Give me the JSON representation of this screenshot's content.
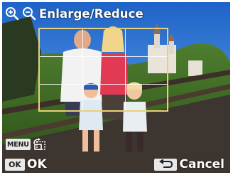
{
  "header": {
    "title": "Enlarge/Reduce",
    "zoom_in_icon": "zoom-in-icon",
    "zoom_out_icon": "zoom-out-icon"
  },
  "image": {
    "description_icon": "family-photo"
  },
  "menu": {
    "menu_label": "MENU",
    "rotate_icon": "rotate-frame-icon"
  },
  "footer": {
    "ok_chip": "OK",
    "ok_label": "OK",
    "back_icon": "back-arrow-icon",
    "cancel_label": "Cancel"
  },
  "colors": {
    "frame": "#e8d07a",
    "chip_bg": "#e8e8e8",
    "text": "#ffffff"
  }
}
